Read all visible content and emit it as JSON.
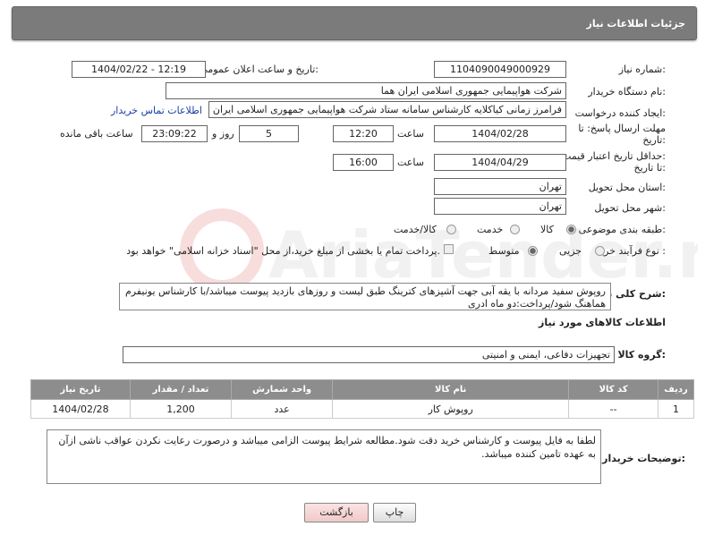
{
  "header": {
    "title": "جزئیات اطلاعات نیاز"
  },
  "fields": {
    "need_number_label": "شماره نیاز:",
    "need_number": "1104090049000929",
    "announce_label": "تاریخ و ساعت اعلان عمومی:",
    "announce_value": "1404/02/22 - 12:19",
    "buyer_label": "نام دستگاه خریدار:",
    "buyer_value": "شرکت هواپیمایی جمهوری اسلامی ایران هما",
    "creator_label": "ایجاد کننده درخواست:",
    "creator_value": "فرامرز زمانی کیاکلایه کارشناس سامانه ستاد شرکت هواپیمایی جمهوری اسلامی ایران هما",
    "contact_link": "اطلاعات تماس خریدار",
    "deadline_label_1": "مهلت ارسال پاسخ: تا",
    "deadline_label_2": "تاریخ:",
    "deadline_date": "1404/02/28",
    "time_label": "ساعت",
    "deadline_time": "12:20",
    "days_value": "5",
    "days_label": "روز و",
    "remaining_value": "23:09:22",
    "remaining_label": "ساعت باقی مانده",
    "validity_label_1": "حداقل تاریخ اعتبار قیمت:",
    "validity_label_2": "تا تاریخ:",
    "validity_date": "1404/04/29",
    "validity_time_label": "ساعت",
    "validity_time": "16:00",
    "province_label": "استان محل تحویل:",
    "province_value": "تهران",
    "city_label": "شهر محل تحویل:",
    "city_value": "تهران",
    "category_label": "طبقه بندی موضوعی:",
    "category_options": [
      "کالا",
      "خدمت",
      "کالا/خدمت"
    ],
    "process_label": "نوع فرآیند خرید :",
    "process_options": [
      "جزیی",
      "متوسط"
    ],
    "payment_note": "پرداخت تمام یا بخشی از مبلغ خرید،از محل \"اسناد خزانه اسلامی\" خواهد بود.",
    "desc_label": "شرح کلی نیاز:",
    "desc_value": "روپوش سفید مردانه با یقه آبی جهت آشپزهای کترینگ طبق لیست و روزهای بازدید پیوست میباشد/با کارشناس یونیفرم هماهنگ شود/پرداخت:دو ماه ادری"
  },
  "goods": {
    "section_title": "اطلاعات کالاهای مورد نیاز",
    "group_label": "گروه کالا:",
    "group_value": "تجهیزات دفاعی، ایمنی و امنیتی",
    "columns": [
      "ردیف",
      "کد کالا",
      "نام کالا",
      "واحد شمارش",
      "تعداد / مقدار",
      "تاریخ نیاز"
    ],
    "rows": [
      [
        "1",
        "--",
        "روپوش کار",
        "عدد",
        "1,200",
        "1404/02/28"
      ]
    ]
  },
  "notes": {
    "label": "توضیحات خریدار:",
    "value": "لطفا به فایل پیوست و کارشناس خرید دقت شود.مطالعه شرایط پیوست الزامی میباشد و درصورت رعایت نکردن عواقب ناشی ازآن به عهده تامین کننده میباشد."
  },
  "buttons": {
    "print": "چاپ",
    "back": "بازگشت"
  },
  "colors": {
    "header": "#7b7b7b",
    "link": "#1a3fa8",
    "back_button": "#f6d4d4"
  },
  "watermark": "AriaTender.net"
}
